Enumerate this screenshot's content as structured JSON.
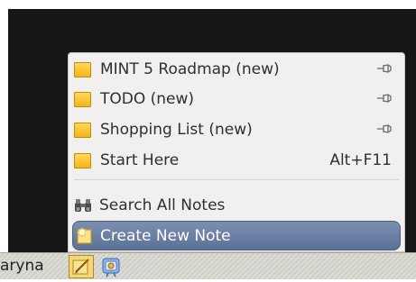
{
  "menu": {
    "items": [
      {
        "label": "MINT 5 Roadmap (new)",
        "icon": "note-icon",
        "pinned": true
      },
      {
        "label": "TODO (new)",
        "icon": "note-icon",
        "pinned": true
      },
      {
        "label": "Shopping List (new)",
        "icon": "note-icon",
        "pinned": true
      },
      {
        "label": "Start Here",
        "icon": "note-icon",
        "shortcut": "Alt+F11"
      }
    ],
    "search": {
      "label": "Search All Notes",
      "icon": "binoculars-icon"
    },
    "create": {
      "label": "Create New Note",
      "icon": "new-note-icon",
      "selected": true
    }
  },
  "taskbar": {
    "user_label": "aryna",
    "applets": [
      {
        "icon": "tomboy-notes-icon",
        "active": true
      },
      {
        "icon": "network-icon",
        "active": false
      }
    ]
  },
  "colors": {
    "menu_bg": "#f1f0ee",
    "selection": "#5b7197",
    "note_yellow": "#f1b61a",
    "desktop_bg": "#161616"
  }
}
